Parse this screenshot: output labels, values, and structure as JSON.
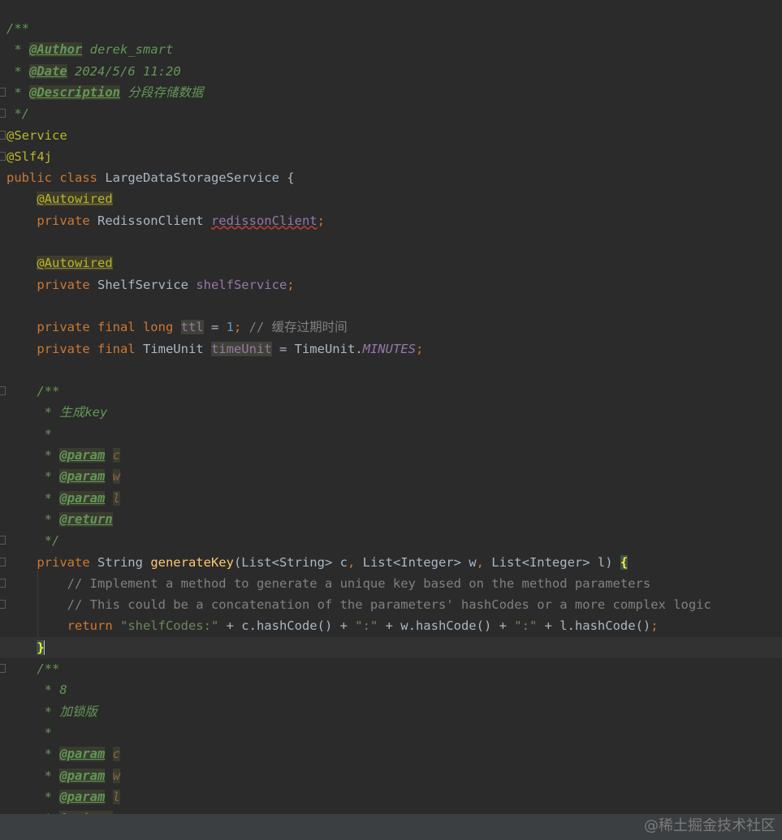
{
  "lines": [
    {
      "tokens": [
        {
          "c": "t-com",
          "t": "/**"
        }
      ]
    },
    {
      "tokens": [
        {
          "c": "t-com",
          "t": " * "
        },
        {
          "c": "t-tag",
          "t": "@Author"
        },
        {
          "c": "t-com",
          "t": " derek_smart"
        }
      ]
    },
    {
      "tokens": [
        {
          "c": "t-com",
          "t": " * "
        },
        {
          "c": "t-tag",
          "t": "@Date"
        },
        {
          "c": "t-com",
          "t": " 2024/5/6 11:20"
        }
      ]
    },
    {
      "tokens": [
        {
          "c": "t-com",
          "t": " * "
        },
        {
          "c": "t-tag",
          "t": "@Description"
        },
        {
          "c": "t-com",
          "t": " 分段存储数据"
        }
      ]
    },
    {
      "tokens": [
        {
          "c": "t-com",
          "t": " */"
        }
      ]
    },
    {
      "tokens": [
        {
          "c": "t-ann",
          "t": "@Service"
        }
      ]
    },
    {
      "tokens": [
        {
          "c": "t-ann",
          "t": "@Slf4j"
        }
      ]
    },
    {
      "tokens": [
        {
          "c": "t-kw",
          "t": "public class "
        },
        {
          "c": "t-id",
          "t": "LargeDataStorageService {"
        }
      ]
    },
    {
      "tokens": [
        {
          "c": "t-id",
          "t": "    "
        },
        {
          "c": "t-ann warn",
          "t": "@Autowired"
        }
      ]
    },
    {
      "tokens": [
        {
          "c": "t-kw",
          "t": "    private "
        },
        {
          "c": "t-id",
          "t": "RedissonClient "
        },
        {
          "c": "t-fld err",
          "t": "redissonClient"
        },
        {
          "c": "t-kw",
          "t": ";"
        }
      ]
    },
    {
      "tokens": []
    },
    {
      "tokens": [
        {
          "c": "t-id",
          "t": "    "
        },
        {
          "c": "t-ann warn",
          "t": "@Autowired"
        }
      ]
    },
    {
      "tokens": [
        {
          "c": "t-kw",
          "t": "    private "
        },
        {
          "c": "t-id",
          "t": "ShelfService "
        },
        {
          "c": "t-fld",
          "t": "shelfService"
        },
        {
          "c": "t-kw",
          "t": ";"
        }
      ]
    },
    {
      "tokens": []
    },
    {
      "tokens": [
        {
          "c": "t-kw",
          "t": "    private final long "
        },
        {
          "c": "t-fld t-hl",
          "t": "ttl"
        },
        {
          "c": "t-id",
          "t": " = "
        },
        {
          "c": "t-num",
          "t": "1"
        },
        {
          "c": "t-kw",
          "t": ";"
        },
        {
          "c": "t-lc",
          "t": " // 缓存过期时间"
        }
      ]
    },
    {
      "tokens": [
        {
          "c": "t-kw",
          "t": "    private final "
        },
        {
          "c": "t-id",
          "t": "TimeUnit "
        },
        {
          "c": "t-fld t-hl",
          "t": "timeUnit"
        },
        {
          "c": "t-id",
          "t": " = TimeUnit."
        },
        {
          "c": "t-static",
          "t": "MINUTES"
        },
        {
          "c": "t-kw",
          "t": ";"
        }
      ]
    },
    {
      "tokens": []
    },
    {
      "tokens": [
        {
          "c": "t-com",
          "t": "    /**"
        }
      ]
    },
    {
      "tokens": [
        {
          "c": "t-com",
          "t": "     * 生成key"
        }
      ]
    },
    {
      "tokens": [
        {
          "c": "t-com",
          "t": "     *"
        }
      ]
    },
    {
      "tokens": [
        {
          "c": "t-com",
          "t": "     * "
        },
        {
          "c": "t-tag",
          "t": "@param"
        },
        {
          "c": "t-com",
          "t": " "
        },
        {
          "c": "t-tagv",
          "t": "c"
        }
      ]
    },
    {
      "tokens": [
        {
          "c": "t-com",
          "t": "     * "
        },
        {
          "c": "t-tag",
          "t": "@param"
        },
        {
          "c": "t-com",
          "t": " "
        },
        {
          "c": "t-tagv",
          "t": "w"
        }
      ]
    },
    {
      "tokens": [
        {
          "c": "t-com",
          "t": "     * "
        },
        {
          "c": "t-tag",
          "t": "@param"
        },
        {
          "c": "t-com",
          "t": " "
        },
        {
          "c": "t-tagv",
          "t": "l"
        }
      ]
    },
    {
      "tokens": [
        {
          "c": "t-com",
          "t": "     * "
        },
        {
          "c": "t-tag",
          "t": "@return"
        }
      ]
    },
    {
      "tokens": [
        {
          "c": "t-com",
          "t": "     */"
        }
      ]
    },
    {
      "tokens": [
        {
          "c": "t-kw",
          "t": "    private "
        },
        {
          "c": "t-id",
          "t": "String "
        },
        {
          "c": "t-fn",
          "t": "generateKey"
        },
        {
          "c": "t-id",
          "t": "(List<String> c"
        },
        {
          "c": "t-kw",
          "t": ", "
        },
        {
          "c": "t-id",
          "t": "List<Integer> w"
        },
        {
          "c": "t-kw",
          "t": ", "
        },
        {
          "c": "t-id",
          "t": "List<Integer> l) "
        },
        {
          "c": "t-brace",
          "t": "{"
        }
      ]
    },
    {
      "tokens": [
        {
          "c": "t-lc",
          "t": "        // Implement a method to generate a unique key based on the method parameters"
        }
      ]
    },
    {
      "tokens": [
        {
          "c": "t-lc",
          "t": "        // This could be a concatenation of the parameters' hashCodes or a more complex logic"
        }
      ]
    },
    {
      "tokens": [
        {
          "c": "t-kw",
          "t": "        return "
        },
        {
          "c": "t-str",
          "t": "\"shelfCodes:\""
        },
        {
          "c": "t-id",
          "t": " + c.hashCode() + "
        },
        {
          "c": "t-str",
          "t": "\":\""
        },
        {
          "c": "t-id",
          "t": " + w.hashCode() + "
        },
        {
          "c": "t-str",
          "t": "\":\""
        },
        {
          "c": "t-id",
          "t": " + l.hashCode()"
        },
        {
          "c": "t-kw",
          "t": ";"
        }
      ]
    },
    {
      "current": true,
      "tokens": [
        {
          "c": "t-id",
          "t": "    "
        },
        {
          "c": "t-brace",
          "t": "}"
        }
      ]
    },
    {
      "tokens": [
        {
          "c": "t-com",
          "t": "    /**"
        }
      ]
    },
    {
      "tokens": [
        {
          "c": "t-com",
          "t": "     * 8"
        }
      ]
    },
    {
      "tokens": [
        {
          "c": "t-com",
          "t": "     * 加锁版"
        }
      ]
    },
    {
      "tokens": [
        {
          "c": "t-com",
          "t": "     *"
        }
      ]
    },
    {
      "tokens": [
        {
          "c": "t-com",
          "t": "     * "
        },
        {
          "c": "t-tag",
          "t": "@param"
        },
        {
          "c": "t-com",
          "t": " "
        },
        {
          "c": "t-tagv",
          "t": "c"
        }
      ]
    },
    {
      "tokens": [
        {
          "c": "t-com",
          "t": "     * "
        },
        {
          "c": "t-tag",
          "t": "@param"
        },
        {
          "c": "t-com",
          "t": " "
        },
        {
          "c": "t-tagv",
          "t": "w"
        }
      ]
    },
    {
      "tokens": [
        {
          "c": "t-com",
          "t": "     * "
        },
        {
          "c": "t-tag",
          "t": "@param"
        },
        {
          "c": "t-com",
          "t": " "
        },
        {
          "c": "t-tagv",
          "t": "l"
        }
      ]
    },
    {
      "tokens": [
        {
          "c": "t-com",
          "t": "     * "
        },
        {
          "c": "t-tag",
          "t": "@return"
        }
      ]
    }
  ],
  "watermark": "@稀土掘金技术社区"
}
